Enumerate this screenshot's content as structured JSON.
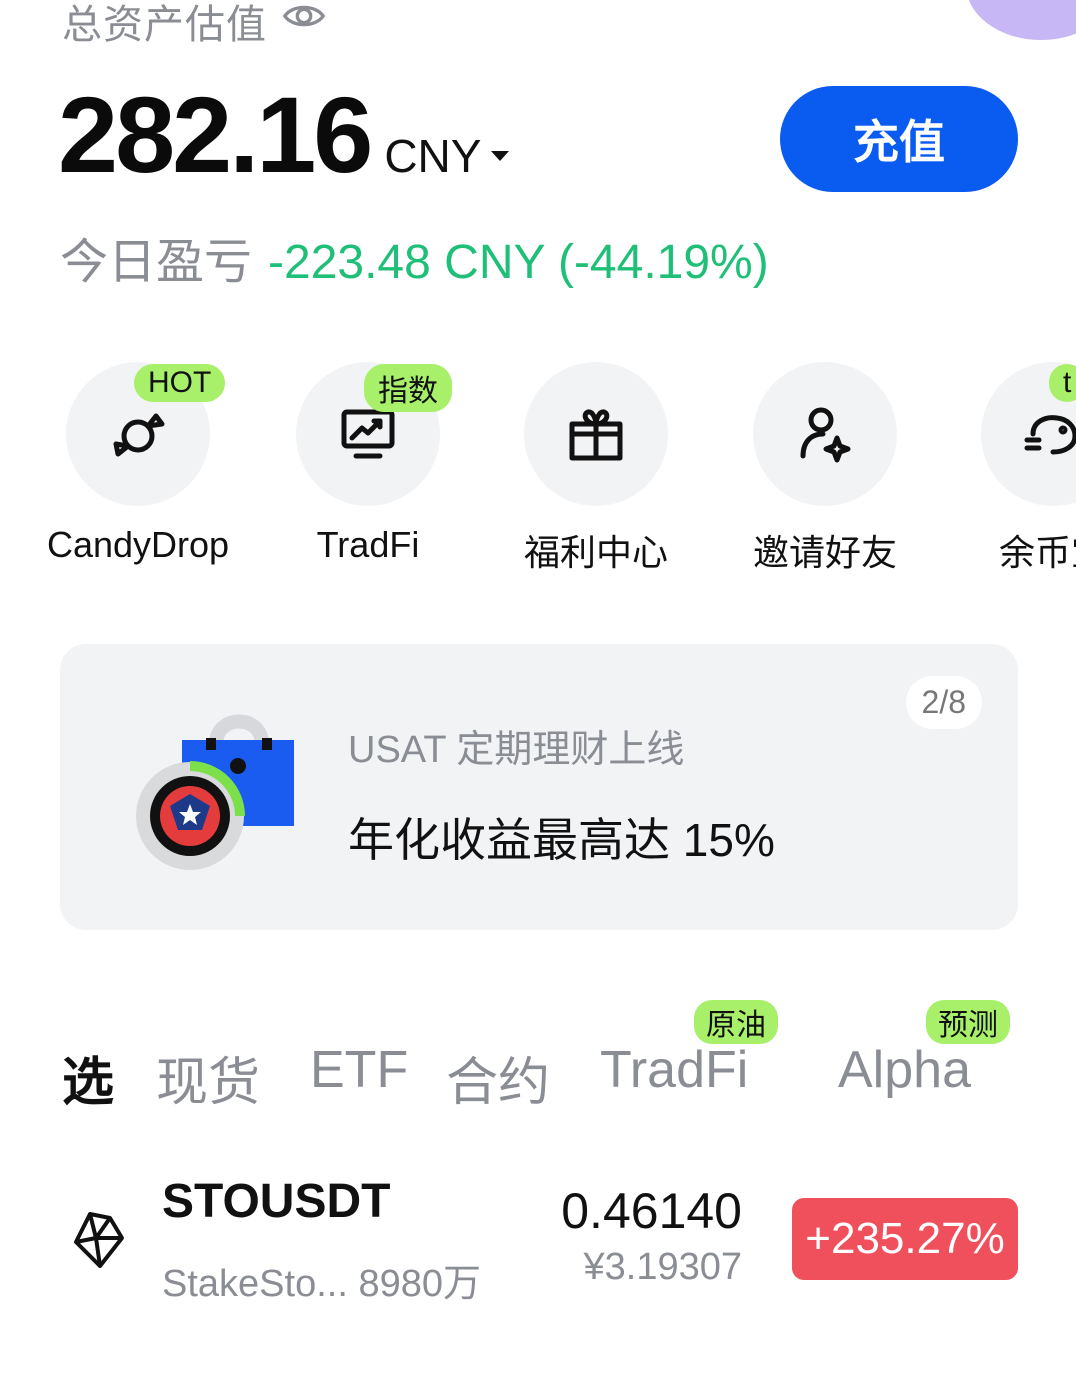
{
  "header": {
    "asset_label": "总资产估值",
    "balance": "282.16",
    "currency": "CNY",
    "deposit_label": "充值",
    "pnl_label": "今日盈亏",
    "pnl_value": "-223.48 CNY (-44.19%)"
  },
  "shortcuts": [
    {
      "label": "CandyDrop",
      "badge": "HOT",
      "icon": "candy-icon"
    },
    {
      "label": "TradFi",
      "badge": "指数",
      "icon": "chart-monitor-icon"
    },
    {
      "label": "福利中心",
      "badge": "",
      "icon": "gift-icon"
    },
    {
      "label": "邀请好友",
      "badge": "",
      "icon": "invite-user-icon"
    },
    {
      "label": "余币宝",
      "badge": "t",
      "icon": "piggy-bank-icon"
    }
  ],
  "banner": {
    "pager": "2/8",
    "subtitle": "USAT 定期理财上线",
    "title": "年化收益最高达 15%"
  },
  "tabs": [
    {
      "label": "选",
      "badge": ""
    },
    {
      "label": "现货",
      "badge": ""
    },
    {
      "label": "ETF",
      "badge": ""
    },
    {
      "label": "合约",
      "badge": ""
    },
    {
      "label": "TradFi",
      "badge": "原油"
    },
    {
      "label": "Alpha",
      "badge": "预测"
    }
  ],
  "market": [
    {
      "pair": "STOUSDT",
      "name": "StakeSto...",
      "volume": "8980万",
      "price": "0.46140",
      "price_cny": "¥3.19307",
      "change": "+235.27%",
      "icon": "stakestone-icon"
    }
  ],
  "colors": {
    "accent": "#0a5bf0",
    "gain": "#1fbf78",
    "loss_badge": "#f0505c",
    "badge": "#a8f06a"
  }
}
